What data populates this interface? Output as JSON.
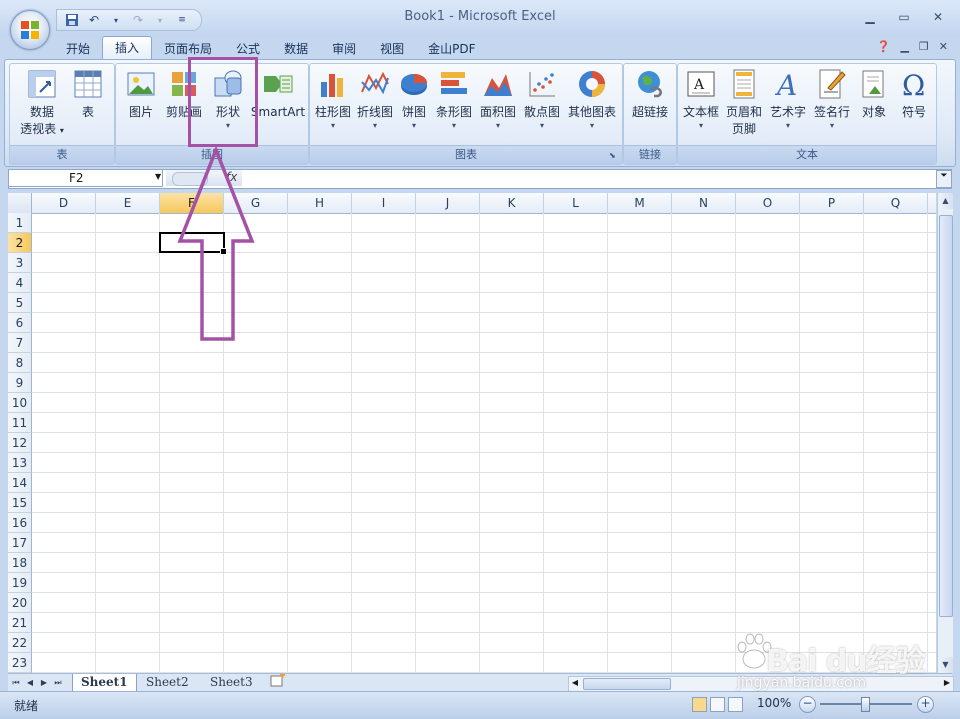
{
  "window": {
    "title": "Book1 - Microsoft Excel"
  },
  "ribbon_tabs": [
    "开始",
    "插入",
    "页面布局",
    "公式",
    "数据",
    "审阅",
    "视图",
    "金山PDF"
  ],
  "active_tab": "插入",
  "groups": {
    "table": {
      "label": "表",
      "buttons": {
        "pivot_line1": "数据",
        "pivot_line2": "透视表",
        "table": "表"
      }
    },
    "illustrations": {
      "label": "插图",
      "buttons": {
        "picture": "图片",
        "clipart": "剪贴画",
        "shapes": "形状",
        "smartart": "SmartArt"
      }
    },
    "charts": {
      "label": "图表",
      "buttons": {
        "column": "柱形图",
        "line": "折线图",
        "pie": "饼图",
        "bar": "条形图",
        "area": "面积图",
        "scatter": "散点图",
        "other": "其他图表"
      }
    },
    "links": {
      "label": "链接",
      "buttons": {
        "hyperlink": "超链接"
      }
    },
    "text": {
      "label": "文本",
      "buttons": {
        "textbox": "文本框",
        "header_line1": "页眉和",
        "header_line2": "页脚",
        "wordart": "艺术字",
        "signature": "签名行",
        "object": "对象",
        "symbol": "符号"
      }
    }
  },
  "formula_bar": {
    "name_box": "F2",
    "fx": "fx",
    "value": ""
  },
  "grid": {
    "columns": [
      "D",
      "E",
      "F",
      "G",
      "H",
      "I",
      "J",
      "K",
      "L",
      "M",
      "N",
      "O",
      "P",
      "Q"
    ],
    "rows": [
      "1",
      "2",
      "3",
      "4",
      "5",
      "6",
      "7",
      "8",
      "9",
      "10",
      "11",
      "12",
      "13",
      "14",
      "15",
      "16",
      "17",
      "18",
      "19",
      "20",
      "21",
      "22",
      "23"
    ],
    "active_column": "F",
    "active_row": "2"
  },
  "sheets": [
    "Sheet1",
    "Sheet2",
    "Sheet3"
  ],
  "active_sheet": "Sheet1",
  "status": {
    "text": "就绪",
    "zoom": "100%"
  },
  "watermark": {
    "brand": "Bai du经验",
    "url": "jingyan.baidu.com"
  },
  "colors": {
    "highlight": "#a552a6",
    "active_header": "#f6c75c"
  }
}
